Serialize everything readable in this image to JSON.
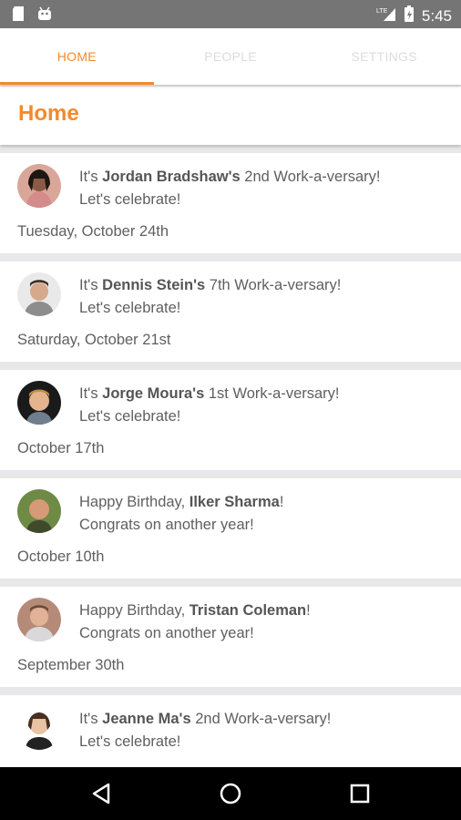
{
  "status_bar": {
    "time": "5:45",
    "network": "LTE"
  },
  "tabs": [
    {
      "label": "HOME",
      "active": true
    },
    {
      "label": "PEOPLE",
      "active": false
    },
    {
      "label": "SETTINGS",
      "active": false
    }
  ],
  "page_title": "Home",
  "colors": {
    "accent": "#f28a2e",
    "text": "#5f5f5f",
    "divider": "#e8e8ea"
  },
  "feed": [
    {
      "prefix": "It's ",
      "name": "Jordan Bradshaw's",
      "suffix": " 2nd Work-a-versary!",
      "line2": "Let's celebrate!",
      "date": "Tuesday, October 24th",
      "avatar_icon": "person-avatar-1"
    },
    {
      "prefix": "It's ",
      "name": "Dennis Stein's",
      "suffix": " 7th Work-a-versary!",
      "line2": "Let's celebrate!",
      "date": "Saturday, October 21st",
      "avatar_icon": "person-avatar-2"
    },
    {
      "prefix": "It's ",
      "name": "Jorge Moura's",
      "suffix": " 1st Work-a-versary!",
      "line2": "Let's celebrate!",
      "date": "October 17th",
      "avatar_icon": "person-avatar-3"
    },
    {
      "prefix": "Happy Birthday, ",
      "name": "Ilker Sharma",
      "suffix": "!",
      "line2": "Congrats on another year!",
      "date": "October 10th",
      "avatar_icon": "person-avatar-4"
    },
    {
      "prefix": "Happy Birthday, ",
      "name": "Tristan Coleman",
      "suffix": "!",
      "line2": "Congrats on another year!",
      "date": "September 30th",
      "avatar_icon": "person-avatar-5"
    },
    {
      "prefix": "It's ",
      "name": "Jeanne Ma's",
      "suffix": " 2nd Work-a-versary!",
      "line2": "Let's celebrate!",
      "date": "",
      "avatar_icon": "person-avatar-6"
    }
  ]
}
